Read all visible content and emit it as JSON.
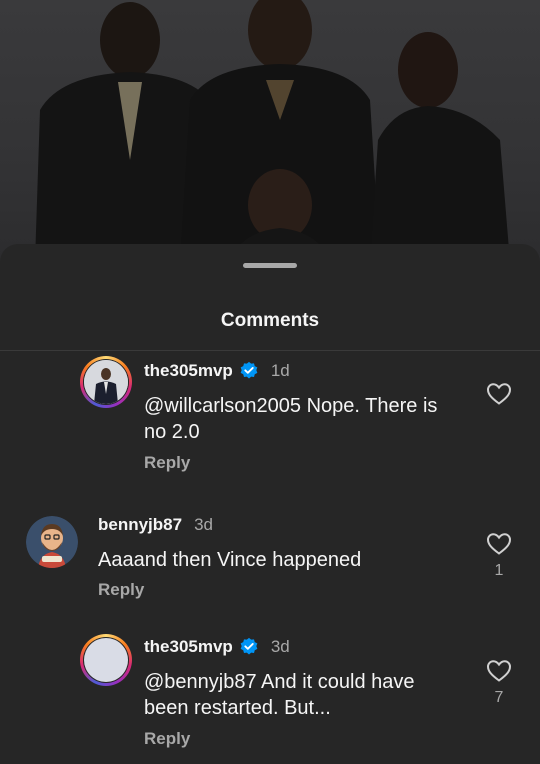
{
  "sheet": {
    "title": "Comments"
  },
  "comments": [
    {
      "username": "the305mvp",
      "verified": true,
      "time": "1d",
      "text": "@willcarlson2005 Nope. There is no 2.0",
      "reply_label": "Reply",
      "likes": ""
    },
    {
      "username": "bennyjb87",
      "verified": false,
      "time": "3d",
      "text": "Aaaand then Vince happened",
      "reply_label": "Reply",
      "likes": "1"
    },
    {
      "username": "the305mvp",
      "verified": true,
      "time": "3d",
      "text": "@bennyjb87 And it could have been restarted. But...",
      "reply_label": "Reply",
      "likes": "7"
    }
  ],
  "colors": {
    "background": "#262626",
    "verified_blue": "#0095f6",
    "secondary_text": "#a8a8a8"
  }
}
